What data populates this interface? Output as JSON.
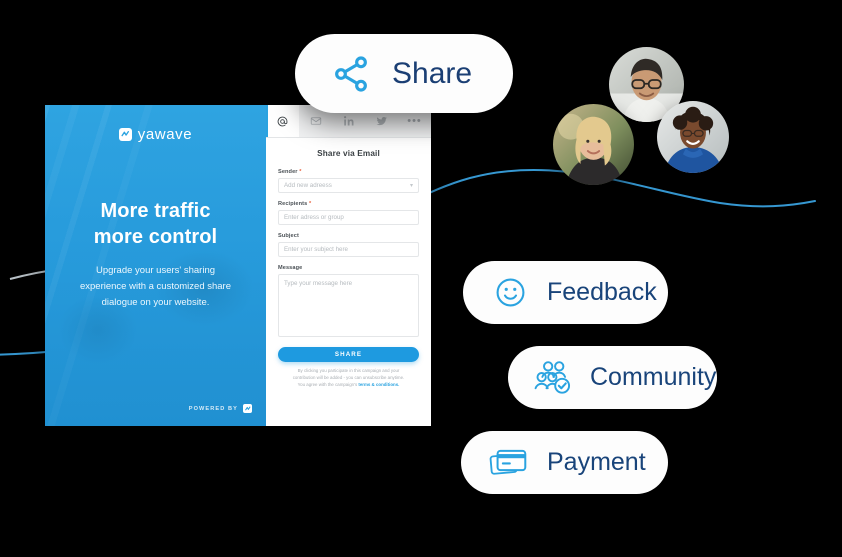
{
  "background_color": "#000000",
  "accent_blue": "#1e9ae0",
  "navy_text": "#1b3f74",
  "hero": {
    "brand_name": "yawave",
    "brand_mark_icon": "yawave-logo-icon",
    "title_line1": "More traffic",
    "title_line2": "more control",
    "subtitle": "Upgrade your users' sharing experience with a customized share dialogue on your website.",
    "powered_by_label": "POWERED BY",
    "powered_by_icon": "yawave-logo-icon",
    "background_color": "#2aa3e0"
  },
  "share_panel": {
    "tabs": [
      {
        "id": "email-at",
        "icon": "at-sign-icon",
        "glyph": "@",
        "active": true
      },
      {
        "id": "mail",
        "icon": "envelope-icon",
        "glyph": "",
        "active": false
      },
      {
        "id": "linkedin",
        "icon": "linkedin-icon",
        "glyph": "in",
        "active": false
      },
      {
        "id": "twitter",
        "icon": "twitter-bird-icon",
        "glyph": "",
        "active": false
      },
      {
        "id": "more",
        "icon": "ellipsis-icon",
        "glyph": "•••",
        "active": false
      }
    ],
    "title": "Share via Email",
    "fields": [
      {
        "label": "Sender",
        "required": true,
        "placeholder": "Add new adreess",
        "type": "select",
        "value": ""
      },
      {
        "label": "Recipients",
        "required": true,
        "placeholder": "Enter adress or group",
        "type": "text",
        "value": ""
      },
      {
        "label": "Subject",
        "required": false,
        "placeholder": "Enter your subject here",
        "type": "text",
        "value": ""
      },
      {
        "label": "Message",
        "required": false,
        "placeholder": "Type your message here",
        "type": "textarea",
        "value": ""
      }
    ],
    "submit_label": "SHARE",
    "disclaimer_line1": "By clicking you participate in this campaign and your",
    "disclaimer_line2": "contribution will be added - you can unsubscribe anytime.",
    "disclaimer_line3_prefix": "You agree with the campaign's ",
    "disclaimer_link": "terms & conditions."
  },
  "pills": [
    {
      "id": "share",
      "label": "Share",
      "icon": "share-nodes-icon"
    },
    {
      "id": "feedback",
      "label": "Feedback",
      "icon": "smiley-face-icon"
    },
    {
      "id": "community",
      "label": "Community",
      "icon": "users-check-icon"
    },
    {
      "id": "payment",
      "label": "Payment",
      "icon": "credit-cards-icon"
    }
  ],
  "avatars": [
    {
      "id": "avatar-man-glasses",
      "alt": "Smiling man with glasses"
    },
    {
      "id": "avatar-woman-blonde",
      "alt": "Smiling blonde woman outdoors"
    },
    {
      "id": "avatar-woman-blue-top",
      "alt": "Smiling woman in blue top"
    }
  ]
}
